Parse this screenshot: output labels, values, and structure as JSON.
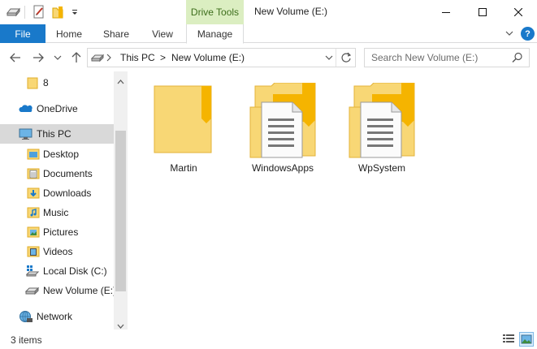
{
  "window": {
    "context_tab_group": "Drive Tools",
    "title": "New Volume (E:)"
  },
  "quick_access": [
    {
      "icon": "drive-icon"
    },
    {
      "icon": "properties-icon"
    },
    {
      "icon": "new-folder-icon"
    },
    {
      "icon": "customize-dropdown-icon"
    }
  ],
  "ribbon": {
    "file_label": "File",
    "tabs": [
      "Home",
      "Share",
      "View",
      "Manage"
    ],
    "help_label": "?"
  },
  "address": {
    "crumbs": [
      "This PC",
      "New Volume (E:)"
    ],
    "separator": ">"
  },
  "search": {
    "placeholder": "Search New Volume (E:)"
  },
  "nav_tree": [
    {
      "label": "8",
      "icon": "folder-icon"
    },
    {
      "label": "OneDrive",
      "icon": "onedrive-icon"
    },
    {
      "label": "This PC",
      "icon": "this-pc-icon",
      "selected": true
    },
    {
      "label": "Desktop",
      "icon": "desktop-folder-icon"
    },
    {
      "label": "Documents",
      "icon": "documents-folder-icon"
    },
    {
      "label": "Downloads",
      "icon": "downloads-folder-icon"
    },
    {
      "label": "Music",
      "icon": "music-folder-icon"
    },
    {
      "label": "Pictures",
      "icon": "pictures-folder-icon"
    },
    {
      "label": "Videos",
      "icon": "videos-folder-icon"
    },
    {
      "label": "Local Disk (C:)",
      "icon": "windows-drive-icon"
    },
    {
      "label": "New Volume (E:)",
      "icon": "drive-icon"
    },
    {
      "label": "Network",
      "icon": "network-icon"
    }
  ],
  "files": [
    {
      "name": "Martin",
      "type": "folder"
    },
    {
      "name": "WindowsApps",
      "type": "folder-with-documents"
    },
    {
      "name": "WpSystem",
      "type": "folder-with-documents"
    }
  ],
  "status": {
    "item_count": "3 items"
  },
  "colors": {
    "file_tab": "#1979ca",
    "context_tab": "#dbeec1",
    "context_text": "#3d6e1c",
    "folder_yellow": "#f8d775",
    "folder_dark": "#f5b400",
    "selected_bg": "#d9d9d9"
  }
}
